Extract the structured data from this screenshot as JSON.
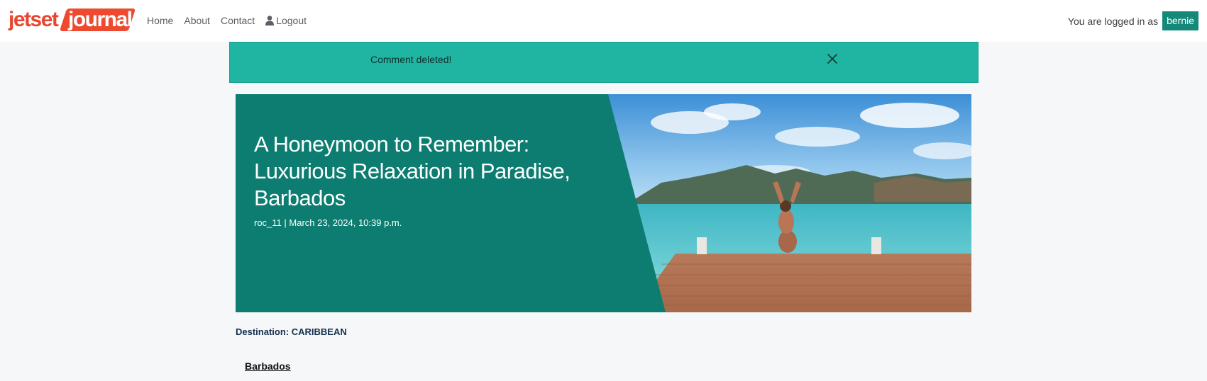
{
  "navbar": {
    "logo": {
      "part1": "jetset",
      "part2": "journal"
    },
    "links": [
      "Home",
      "About",
      "Contact"
    ],
    "logout": {
      "icon": "user-icon",
      "label": "Logout"
    },
    "logged_in_text": "You are logged in as",
    "username": "bernie"
  },
  "alert": {
    "message": "Comment deleted!",
    "close_icon": "close-icon"
  },
  "post": {
    "title": "A Honeymoon to Remember: Luxurious Relaxation in Paradise, Barbados",
    "meta": "roc_11 | March 23, 2024, 10:39 p.m.",
    "image_alt": "woman-on-dock-photo",
    "destination": "Destination: CARIBBEAN",
    "section_heading": "Barbados"
  },
  "colors": {
    "brand_red": "#ee4a30",
    "hero_panel": "#0c7d70",
    "alert_bg": "#20b5a2",
    "user_badge": "#14897a"
  }
}
